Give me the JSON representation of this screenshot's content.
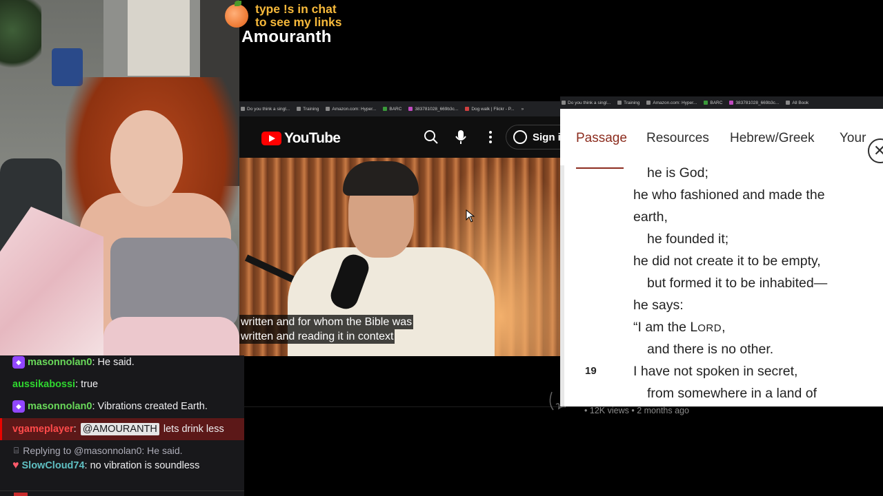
{
  "overlay": {
    "promo_line1": "type !s in chat",
    "promo_line2": "to see my links",
    "streamer_name": "Amouranth"
  },
  "youtube_window": {
    "bookmarks": [
      "Do you think a singl...",
      "Training",
      "Amazon.com: Hyper...",
      "BARC",
      "383781028_669b3c...",
      "Dog walk | Flickr - P..."
    ],
    "logo_text": "YouTube",
    "signin_label": "Sign i",
    "caption_line1": "written and for whom the Bible was",
    "caption_line2": "written and reading it in context"
  },
  "bible_window": {
    "bookmarks": [
      "Do you think a singl...",
      "Training",
      "Amazon.com: Hyper...",
      "BARC",
      "383781028_669b3c...",
      "All Book"
    ],
    "tabs": [
      "Passage",
      "Resources",
      "Hebrew/Greek",
      "Your"
    ],
    "active_tab": "Passage",
    "close_glyph": "✕",
    "lines": [
      "he is God;",
      "he who fashioned and made the",
      "earth,",
      "he founded it;",
      "he did not create it to be empty,",
      "but formed it to be inhabited—",
      "he says:",
      "“I am the ",
      "and there is no other.",
      "I have not spoken in secret,",
      "from somewhere in a land of"
    ],
    "lord_L": "L",
    "lord_rest": "ORD",
    "lord_comma": ",",
    "verse_number": "19"
  },
  "below": {
    "views_text": "12K views",
    "separator": "•",
    "age_text": "2 months ago"
  },
  "chat": {
    "messages": [
      {
        "user": "masonnolan0",
        "text": "He said.",
        "color": "#69d85a"
      },
      {
        "user": "aussikabossi",
        "text": "true",
        "color": "#2fd62f"
      },
      {
        "user": "masonnolan0",
        "text": "Vibrations created Earth.",
        "color": "#69d85a"
      },
      {
        "user": "vgameplayer",
        "mention": "@AMOURANTH",
        "text": "lets drink less",
        "color": "#ff4a4a"
      },
      {
        "reply": "Replying to @masonnolan0: He said."
      },
      {
        "user": "SlowCloud74",
        "text": "no vibration is soundless",
        "color": "#5fc0c3"
      }
    ]
  },
  "colors": {
    "accent_passage": "#8c2c1e",
    "twitch_purple": "#9147ff",
    "youtube_red": "#ff0000",
    "promo_orange": "#f6b93b"
  }
}
